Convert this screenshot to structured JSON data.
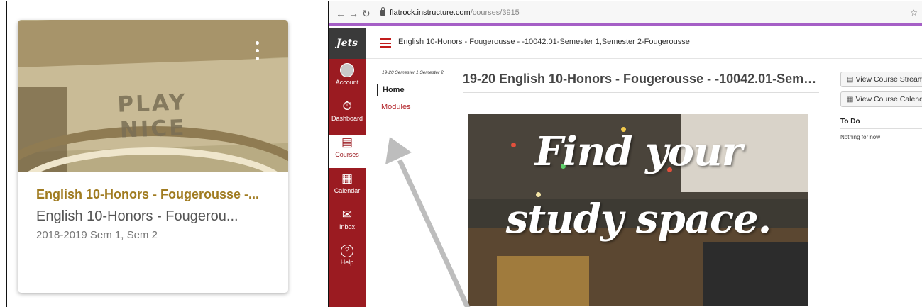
{
  "card": {
    "image_text": "PLAY NICE",
    "title": "English 10-Honors - Fougerousse -...",
    "subtitle": "English 10-Honors - Fougerou...",
    "term": "2018-2019 Sem 1, Sem 2",
    "title_color": "#a07b20"
  },
  "browser": {
    "back_icon": "arrow-left-icon",
    "forward_icon": "arrow-right-icon",
    "reload_icon": "reload-icon",
    "url_host": "flatrock.instructure.com",
    "url_path": "/courses/3915",
    "accent_color": "#a55fc6"
  },
  "global_nav": {
    "logo": "Jets",
    "color": "#9b1b21",
    "items": [
      {
        "label": "Account",
        "icon": "avatar-icon"
      },
      {
        "label": "Dashboard",
        "icon": "dashboard-icon"
      },
      {
        "label": "Courses",
        "icon": "courses-icon"
      },
      {
        "label": "Calendar",
        "icon": "calendar-icon"
      },
      {
        "label": "Inbox",
        "icon": "inbox-icon"
      },
      {
        "label": "Help",
        "icon": "help-icon"
      }
    ]
  },
  "breadcrumb": "English 10-Honors - Fougerousse - -10042.01-Semester 1,Semester 2-Fougerousse",
  "course_nav": {
    "term": "19-20 Semester 1,Semester 2",
    "items": [
      "Home",
      "Modules"
    ]
  },
  "main": {
    "title": "19-20 English 10-Honors - Fougerousse - -10042.01-Semes...",
    "banner_line1": "Find your",
    "banner_line2": "study space."
  },
  "sidebar": {
    "stream_button": "View Course Stream",
    "calendar_button": "View Course Calendar",
    "todo_heading": "To Do",
    "todo_empty": "Nothing for now"
  }
}
